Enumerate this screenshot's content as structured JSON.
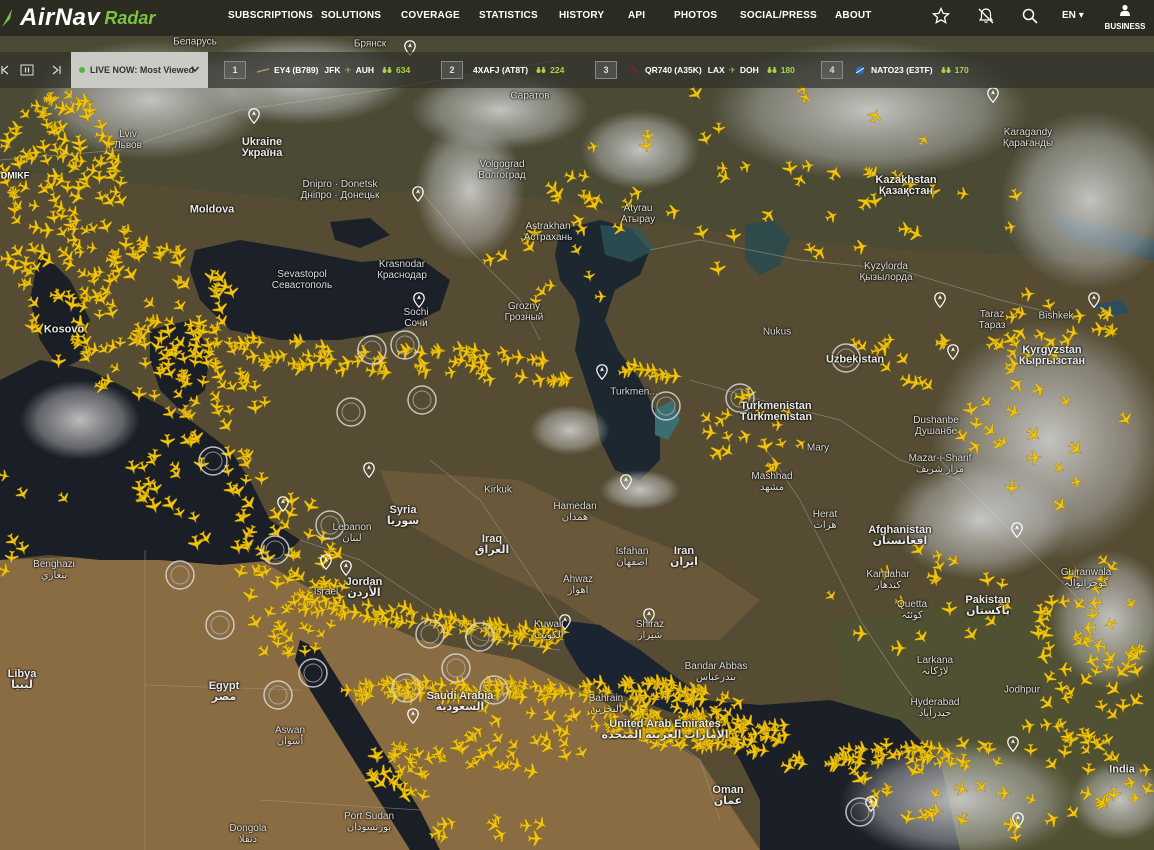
{
  "app": {
    "brand": "AirNav",
    "product": "Radar"
  },
  "nav": {
    "items": [
      "SUBSCRIPTIONS",
      "SOLUTIONS",
      "COVERAGE",
      "STATISTICS",
      "HISTORY",
      "API",
      "PHOTOS",
      "SOCIAL/PRESS",
      "ABOUT"
    ],
    "language": "EN",
    "business": "BUSINESS",
    "icons": [
      "star-icon",
      "notifications-off-icon",
      "search-icon",
      "user-icon"
    ]
  },
  "live_bar": {
    "select_label": "LIVE NOW: Most Viewed",
    "flights": [
      {
        "rank": "1",
        "callsign": "EY4 (B789)",
        "from": "JFK",
        "to": "AUH",
        "viewers": "634"
      },
      {
        "rank": "2",
        "callsign": "4XAFJ (AT8T)",
        "from": "",
        "to": "",
        "viewers": "224"
      },
      {
        "rank": "3",
        "callsign": "QR740 (A35K)",
        "from": "LAX",
        "to": "DOH",
        "viewers": "180"
      },
      {
        "rank": "4",
        "callsign": "NATO23 (E3TF)",
        "from": "",
        "to": "",
        "viewers": "170"
      }
    ]
  },
  "map": {
    "selected_tag": "DMIKF",
    "colors": {
      "aircraft": "#f1c40f",
      "accent": "#7dc243",
      "land": "#5a5237",
      "sea": "#1b2026"
    },
    "labels": [
      {
        "key": "belarus",
        "text": "Беларусь"
      },
      {
        "key": "bryansk",
        "text": "Брянск"
      },
      {
        "key": "saratov",
        "text": "Саратов"
      },
      {
        "key": "lviv",
        "text": "Lviv\nЛьвов"
      },
      {
        "key": "ukraine",
        "text": "Ukraine\nУкраїна"
      },
      {
        "key": "dnipro",
        "text": "Dnipro · Donetsk\nДніпро · Донецьк"
      },
      {
        "key": "volgograd",
        "text": "Volgograd\nВолгоград"
      },
      {
        "key": "atyrau",
        "text": "Atyrau\nАтырау"
      },
      {
        "key": "astrakhan",
        "text": "Astrakhan\nАстрахань"
      },
      {
        "key": "kazakhstan",
        "text": "Kazakhstan\nҚазақстан"
      },
      {
        "key": "karagandy",
        "text": "Karagandy\nҚарағанды"
      },
      {
        "key": "kyzylorda",
        "text": "Kyzylorda\nҚызылорда"
      },
      {
        "key": "moldova",
        "text": "Moldova"
      },
      {
        "key": "sevastopol",
        "text": "Sevastopol\nСевастополь"
      },
      {
        "key": "krasnodar",
        "text": "Krasnodar\nКраснодар"
      },
      {
        "key": "sochi",
        "text": "Sochi\nСочи"
      },
      {
        "key": "grozny",
        "text": "Grozny\nГрозный"
      },
      {
        "key": "taraz",
        "text": "Taraz\nТараз"
      },
      {
        "key": "bishkek",
        "text": "Bishkek"
      },
      {
        "key": "kyrgyzstan",
        "text": "Kyrgyzstan\nКыргызстан"
      },
      {
        "key": "nukus",
        "text": "Nukus"
      },
      {
        "key": "uzbekistan",
        "text": "Uzbekistan"
      },
      {
        "key": "turkmenistan",
        "text": "Turkmenistan\nTürkmenistan"
      },
      {
        "key": "turkmenbashi",
        "text": "Turkmen..."
      },
      {
        "key": "dushanbe",
        "text": "Dushanbe\nДушанбе"
      },
      {
        "key": "mary",
        "text": "Mary"
      },
      {
        "key": "mashhad",
        "text": "Mashhad\nمشهد"
      },
      {
        "key": "mazar",
        "text": "Mazar-i-Sharif\nمزار شریف"
      },
      {
        "key": "herat",
        "text": "Herat\nهرات"
      },
      {
        "key": "afghanistan",
        "text": "Afghanistan\nافغانستان"
      },
      {
        "key": "kosovo",
        "text": "Kosovo"
      },
      {
        "key": "syria",
        "text": "Syria\nسوريا"
      },
      {
        "key": "lebanon",
        "text": "Lebanon\nلبنان"
      },
      {
        "key": "iraq",
        "text": "Iraq\nالعراق"
      },
      {
        "key": "jordan",
        "text": "Jordan\nالأردن"
      },
      {
        "key": "israel",
        "text": "Israel"
      },
      {
        "key": "kirkuk",
        "text": "Kirkuk"
      },
      {
        "key": "hamedan",
        "text": "Hamedan\nهمدان"
      },
      {
        "key": "isfahan",
        "text": "Isfahan\nاصفهان"
      },
      {
        "key": "iran",
        "text": "Iran\nايران"
      },
      {
        "key": "ahvaz",
        "text": "Ahwaz\nاهواز"
      },
      {
        "key": "shiraz",
        "text": "Shiraz\nشیراز"
      },
      {
        "key": "kuwait",
        "text": "Kuwait\nالكويت"
      },
      {
        "key": "kandahar",
        "text": "Kandahar\nکندهار"
      },
      {
        "key": "quetta",
        "text": "Quetta\nکوئٹہ"
      },
      {
        "key": "pakistan",
        "text": "Pakistan\nپاکستان"
      },
      {
        "key": "gujranwala",
        "text": "Gujranwala\nگوجرانوالہ"
      },
      {
        "key": "larkana",
        "text": "Larkana\nلاڑکانہ"
      },
      {
        "key": "hyderabad",
        "text": "Hyderabad\nحیدرآباد"
      },
      {
        "key": "jodhpur",
        "text": "Jodhpur"
      },
      {
        "key": "india",
        "text": "India"
      },
      {
        "key": "bandarabbas",
        "text": "Bandar Abbas\nبندرعباس"
      },
      {
        "key": "bahrain",
        "text": "Bahrain\nالبحرين"
      },
      {
        "key": "uae",
        "text": "United Arab Emirates\nالإمارات العربية المتحدة"
      },
      {
        "key": "saudi",
        "text": "Saudi Arabia\nالسعودية"
      },
      {
        "key": "oman",
        "text": "Oman\nعمان"
      },
      {
        "key": "libya",
        "text": "Libya\nليبيا"
      },
      {
        "key": "egypt",
        "text": "Egypt\nمصر"
      },
      {
        "key": "aswan",
        "text": "Aswan\nأسوان"
      },
      {
        "key": "benghazi",
        "text": "Benghazi\nبنغازي"
      },
      {
        "key": "portsudan",
        "text": "Port Sudan\nبورتسودان"
      },
      {
        "key": "dongola",
        "text": "Dongola\nدنقلا"
      }
    ]
  }
}
